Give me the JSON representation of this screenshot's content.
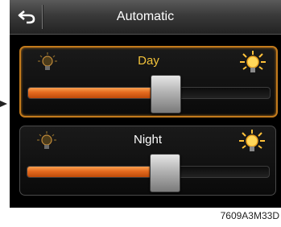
{
  "header": {
    "title": "Automatic",
    "back_icon": "back-arrow-icon"
  },
  "panels": [
    {
      "label": "Day",
      "selected": true,
      "level": 0.57,
      "dim_icon": "lightbulb-dim-icon",
      "bright_icon": "lightbulb-bright-icon"
    },
    {
      "label": "Night",
      "selected": false,
      "level": 0.57,
      "dim_icon": "lightbulb-dim-icon",
      "bright_icon": "lightbulb-bright-icon"
    }
  ],
  "colors": {
    "selected_border": "#c27a1c",
    "slider_fill": "#e46a1e",
    "day_label": "#f2c23a"
  },
  "caption": "7609A3M33D"
}
